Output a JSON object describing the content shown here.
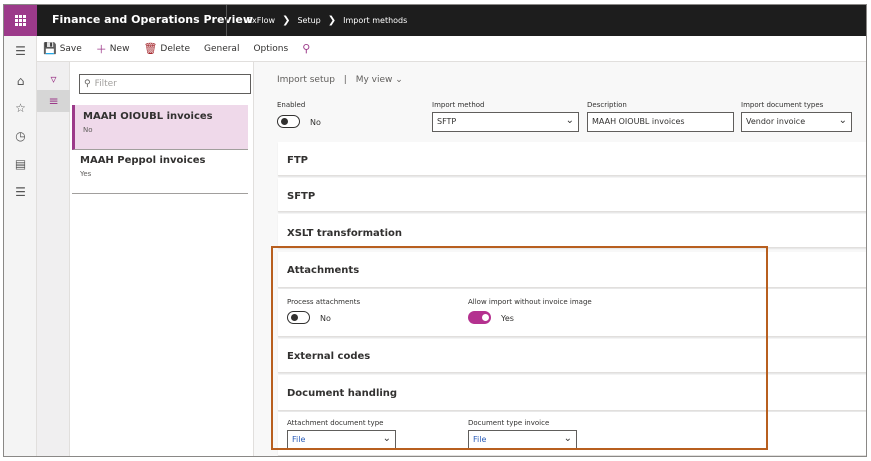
{
  "topbar": {
    "app_title": "Finance and Operations Preview",
    "breadcrumb": [
      "ExFlow",
      "Setup",
      "Import methods"
    ]
  },
  "actions": {
    "save": "Save",
    "new": "New",
    "delete": "Delete",
    "general": "General",
    "options": "Options"
  },
  "list": {
    "filter_placeholder": "Filter",
    "items": [
      {
        "title": "MAAH OIOUBL invoices",
        "subtitle": "No"
      },
      {
        "title": "MAAH Peppol invoices",
        "subtitle": "Yes"
      }
    ]
  },
  "view": {
    "title": "Import setup",
    "separator": "|",
    "view_name": "My view"
  },
  "header_fields": {
    "enabled_label": "Enabled",
    "enabled_value": "No",
    "import_method_label": "Import method",
    "import_method_value": "SFTP",
    "description_label": "Description",
    "description_value": "MAAH OIOUBL invoices",
    "doc_types_label": "Import document types",
    "doc_types_value": "Vendor invoice"
  },
  "sections": {
    "ftp": "FTP",
    "sftp": "SFTP",
    "xslt": "XSLT transformation",
    "attachments": "Attachments",
    "external_codes": "External codes",
    "document_handling": "Document handling"
  },
  "attachments": {
    "process_label": "Process attachments",
    "process_value": "No",
    "allow_label": "Allow import without invoice image",
    "allow_value": "Yes"
  },
  "document_handling": {
    "attachment_type_label": "Attachment document type",
    "attachment_type_value": "File",
    "invoice_type_label": "Document type invoice",
    "invoice_type_value": "File"
  },
  "colors": {
    "accent": "#9c3a8a",
    "highlight_border": "#b85f1f",
    "topbar": "#1d1d1d"
  }
}
